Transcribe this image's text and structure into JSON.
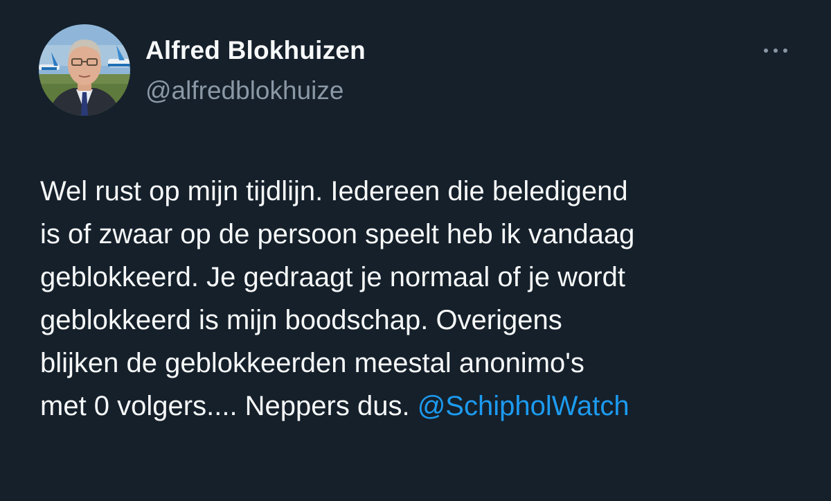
{
  "tweet": {
    "author": {
      "name": "Alfred Blokhuizen",
      "handle": "@alfredblokhuize",
      "avatar": "profile-photo"
    },
    "more_icon": "more-horizontal-icon",
    "text_lines": [
      "Wel rust op mijn tijdlijn. Iedereen die beledigend",
      "is of zwaar op de persoon speelt heb ik vandaag",
      "geblokkeerd. Je gedraagt je normaal of je wordt",
      "geblokkeerd is mijn boodschap. Overigens",
      "blijken de geblokkeerden meestal anonimo's",
      "met 0 volgers.... Neppers dus. "
    ],
    "mention": "@SchipholWatch"
  },
  "colors": {
    "background": "#15202b",
    "text_primary": "#f7f9f9",
    "text_secondary": "#8b98a5",
    "link": "#1d9bf0"
  }
}
